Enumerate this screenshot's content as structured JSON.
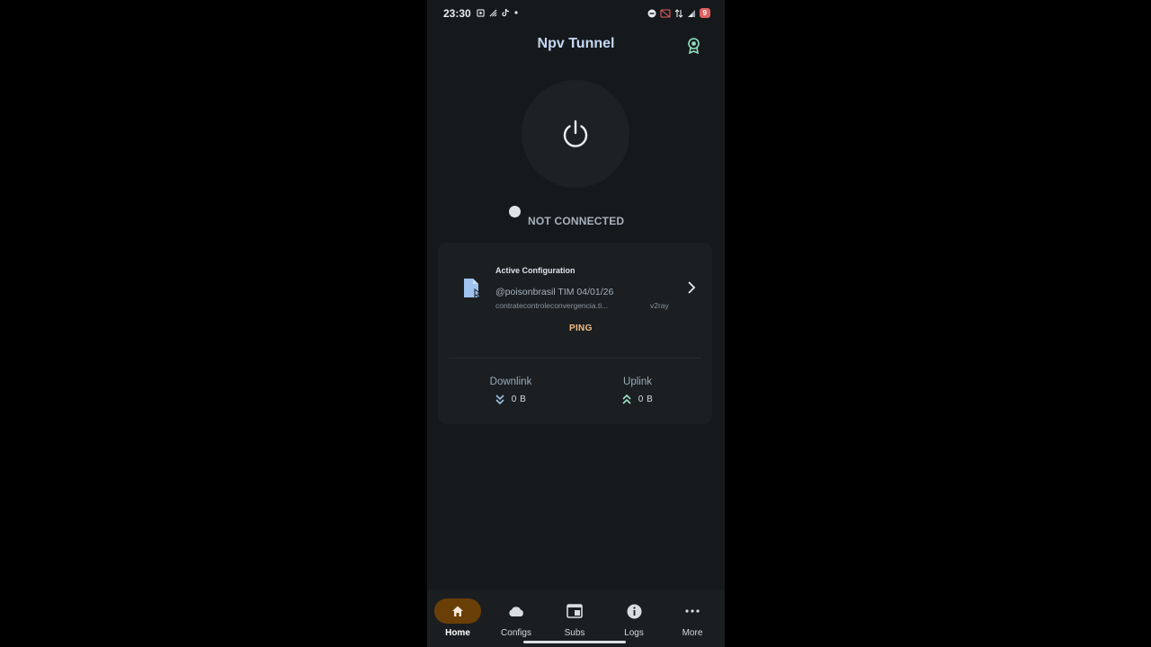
{
  "status_bar": {
    "time": "23:30",
    "battery": "9",
    "left_icons": [
      "screenshot-icon",
      "signal-icon",
      "tiktok-icon",
      "dot-icon"
    ],
    "right_icons": [
      "dnd-icon",
      "cast-off-icon",
      "data-icon",
      "cell-signal-icon",
      "battery-icon"
    ]
  },
  "header": {
    "title": "Npv Tunnel",
    "action_icon": "award-badge-icon"
  },
  "connection": {
    "power_icon": "power-icon",
    "status": "NOT CONNECTED"
  },
  "card": {
    "active_label": "Active Configuration",
    "config_name": "@poisonbrasil TIM 04/01/26",
    "config_host": "contratecontroleconvergencia.ti...",
    "config_type": "v2ray",
    "ping_label": "PING",
    "downlink": {
      "label": "Downlink",
      "value": "0 B"
    },
    "uplink": {
      "label": "Uplink",
      "value": "0 B"
    }
  },
  "nav": {
    "items": [
      {
        "label": "Home",
        "icon": "home-icon",
        "active": true
      },
      {
        "label": "Configs",
        "icon": "cloud-icon",
        "active": false
      },
      {
        "label": "Subs",
        "icon": "subscriptions-icon",
        "active": false
      },
      {
        "label": "Logs",
        "icon": "info-icon",
        "active": false
      },
      {
        "label": "More",
        "icon": "more-icon",
        "active": false
      }
    ]
  },
  "colors": {
    "background": "#16191c",
    "title": "#c4d8f4",
    "accent_ping": "#f3bd86",
    "nav_active": "#6a3f07",
    "badge_icon": "#8fe0c0"
  }
}
